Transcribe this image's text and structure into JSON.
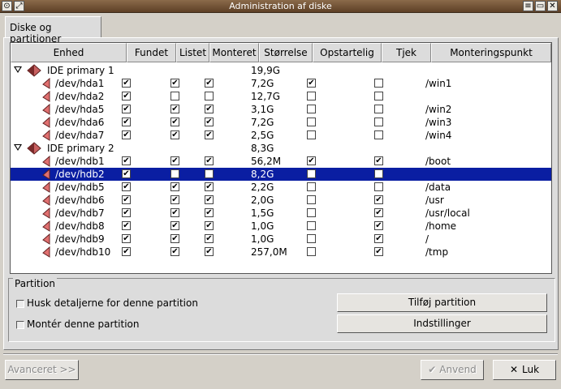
{
  "window": {
    "title": "Administration af diske"
  },
  "tab": {
    "label": "Diske og partitioner"
  },
  "columns": [
    "Enhed",
    "Fundet",
    "Listet",
    "Monteret",
    "Størrelse",
    "Opstartelig",
    "Tjek",
    "Monteringspunkt"
  ],
  "rows": [
    {
      "group": true,
      "name": "IDE primary 1",
      "size": "19,9G"
    },
    {
      "name": "/dev/hda1",
      "fundet": true,
      "listet": true,
      "monteret": true,
      "size": "7,2G",
      "boot": true,
      "tjek": false,
      "mount": "/win1"
    },
    {
      "name": "/dev/hda2",
      "fundet": true,
      "listet": false,
      "monteret": false,
      "size": "12,7G",
      "boot": false,
      "tjek": false,
      "mount": ""
    },
    {
      "name": "/dev/hda5",
      "fundet": true,
      "listet": true,
      "monteret": true,
      "size": "3,1G",
      "boot": false,
      "tjek": false,
      "mount": "/win2"
    },
    {
      "name": "/dev/hda6",
      "fundet": true,
      "listet": true,
      "monteret": true,
      "size": "7,2G",
      "boot": false,
      "tjek": false,
      "mount": "/win3"
    },
    {
      "name": "/dev/hda7",
      "fundet": true,
      "listet": true,
      "monteret": true,
      "size": "2,5G",
      "boot": false,
      "tjek": false,
      "mount": "/win4"
    },
    {
      "group": true,
      "name": "IDE primary 2",
      "size": "8,3G"
    },
    {
      "name": "/dev/hdb1",
      "fundet": true,
      "listet": true,
      "monteret": true,
      "size": "56,2M",
      "boot": true,
      "tjek": true,
      "mount": "/boot"
    },
    {
      "name": "/dev/hdb2",
      "fundet": true,
      "listet": false,
      "monteret": false,
      "size": "8,2G",
      "boot": false,
      "tjek": false,
      "mount": "",
      "selected": true
    },
    {
      "name": "/dev/hdb5",
      "fundet": true,
      "listet": true,
      "monteret": true,
      "size": "2,2G",
      "boot": false,
      "tjek": false,
      "mount": "/data"
    },
    {
      "name": "/dev/hdb6",
      "fundet": true,
      "listet": true,
      "monteret": true,
      "size": "2,0G",
      "boot": false,
      "tjek": true,
      "mount": "/usr"
    },
    {
      "name": "/dev/hdb7",
      "fundet": true,
      "listet": true,
      "monteret": true,
      "size": "1,5G",
      "boot": false,
      "tjek": true,
      "mount": "/usr/local"
    },
    {
      "name": "/dev/hdb8",
      "fundet": true,
      "listet": true,
      "monteret": true,
      "size": "1,0G",
      "boot": false,
      "tjek": true,
      "mount": "/home"
    },
    {
      "name": "/dev/hdb9",
      "fundet": true,
      "listet": true,
      "monteret": true,
      "size": "1,0G",
      "boot": false,
      "tjek": true,
      "mount": "/"
    },
    {
      "name": "/dev/hdb10",
      "fundet": true,
      "listet": true,
      "monteret": true,
      "size": "257,0M",
      "boot": false,
      "tjek": true,
      "mount": "/tmp"
    }
  ],
  "partition": {
    "group_label": "Partition",
    "remember_label": "Husk detaljerne for denne partition",
    "mount_label": "Montér denne partition",
    "add_button": "Tilføj partition",
    "settings_button": "Indstillinger"
  },
  "footer": {
    "advanced_button": "Avanceret >>",
    "apply_button": "Anvend",
    "close_button": "Luk"
  },
  "colors": {
    "selection": "#0a1ea2",
    "titlebar": "#6e5034",
    "disk_icon": "#c86060"
  },
  "icons": {
    "titlebar_left": [
      "menu-icon",
      "maximize-icon"
    ],
    "titlebar_right": [
      "shade-icon",
      "restore-icon",
      "close-icon"
    ],
    "apply": "checkmark-icon",
    "close": "x-icon"
  }
}
